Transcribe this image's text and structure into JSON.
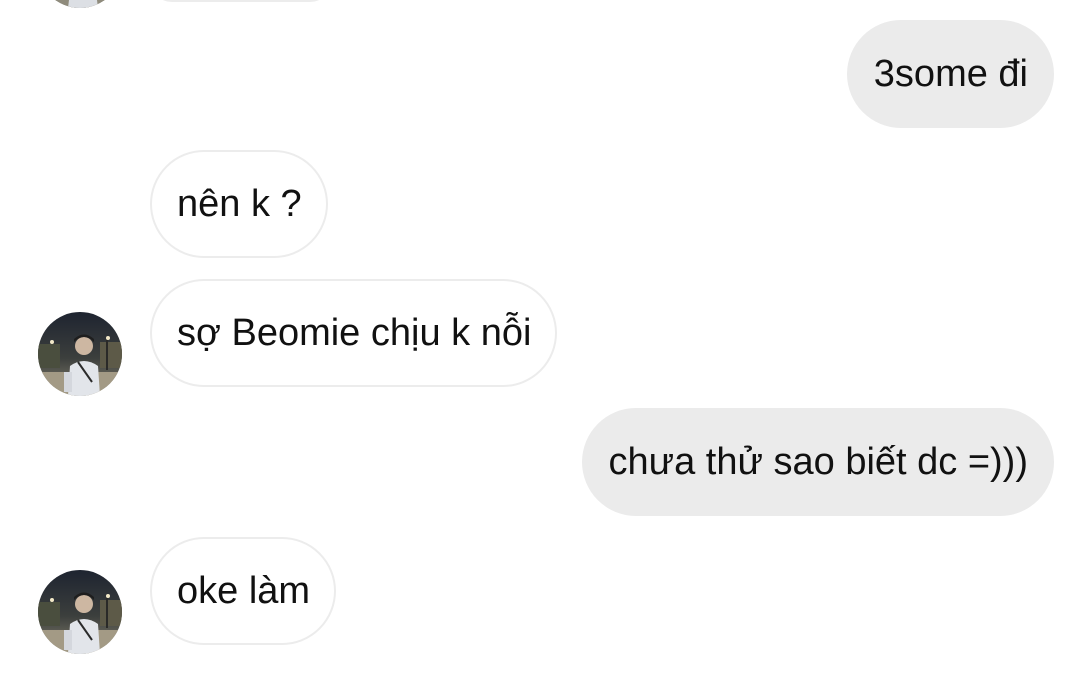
{
  "conversation": {
    "messages": [
      {
        "direction": "outgoing",
        "text": "3some đi"
      },
      {
        "direction": "incoming",
        "text": "nên k ?"
      },
      {
        "direction": "incoming",
        "text": "sợ Beomie chịu k nỗi"
      },
      {
        "direction": "outgoing",
        "text": "chưa thử sao biết dc =)))"
      },
      {
        "direction": "incoming",
        "text": "oke làm"
      }
    ]
  },
  "colors": {
    "outgoing_bubble": "#ebebeb",
    "incoming_bubble": "#ffffff",
    "incoming_border": "#ececec",
    "text": "#111111"
  }
}
